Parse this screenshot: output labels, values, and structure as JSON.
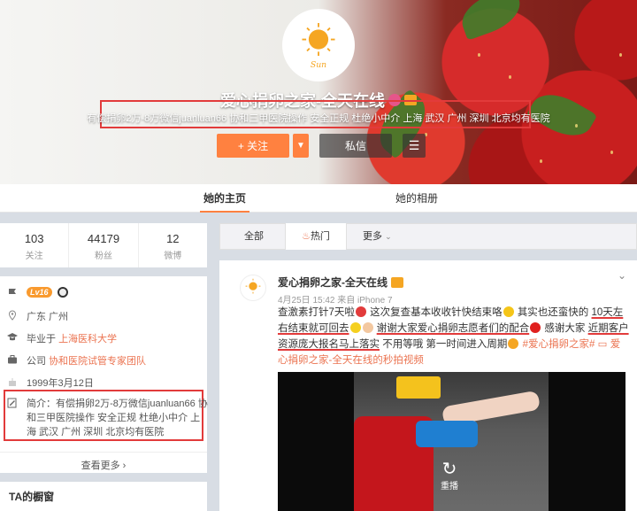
{
  "profile": {
    "name": "爱心捐卵之家-全天在线",
    "intro": "有偿捐卵2万-8万微信juanluan66 协和三甲医院操作 安全正规 杜绝小中介 上海 武汉 广州 深圳 北京均有医院",
    "avatar_text": "Sun",
    "follow_label": "+ 关注",
    "message_label": "私信"
  },
  "tabs": {
    "home": "她的主页",
    "photos": "她的相册"
  },
  "stats": [
    {
      "num": "103",
      "label": "关注"
    },
    {
      "num": "44179",
      "label": "粉丝"
    },
    {
      "num": "12",
      "label": "微博"
    }
  ],
  "info": {
    "level": "Lv16",
    "location": "广东 广州",
    "school_prefix": "毕业于",
    "school": "上海医科大学",
    "company_prefix": "公司",
    "company": "协和医院试管专家团队",
    "birthday": "1999年3月12日",
    "bio": "简介：有偿捐卵2万-8万微信juanluan66 协和三甲医院操作 安全正规 杜绝小中介 上海 武汉 广州 深圳 北京均有医院",
    "see_more": "查看更多 ›"
  },
  "showcase_title": "TA的橱窗",
  "feed_tabs": {
    "all": "全部",
    "hot": "热门",
    "more": "更多"
  },
  "post": {
    "author": "爱心捐卵之家-全天在线",
    "meta": "4月25日 15:42 来自 iPhone 7",
    "text_1": "查激素打针7天啦",
    "text_2": "这次复查基本收收针快结束咯",
    "text_3": "其实也还蛮快的",
    "text_4": "10天左右结束就可回去",
    "text_5": "谢谢大家爱心捐卵志愿者们的配合",
    "text_6": "感谢大家",
    "text_7": "近期客户资源庞大报名马上落实",
    "text_8": "不用等哦 第一时间进入周期",
    "hashtag": "#爱心捐卵之家#",
    "link_text": "爱心捐卵之家-全天在线的秒拍视频",
    "replay_label": "重播"
  },
  "colors": {
    "accent": "#ff8140",
    "link": "#eb7350",
    "highlight_box": "#e23b3b"
  }
}
